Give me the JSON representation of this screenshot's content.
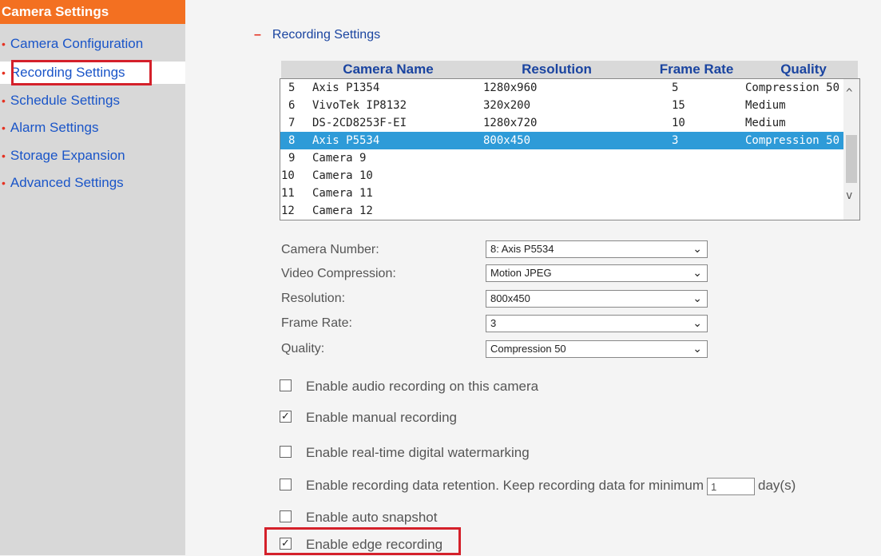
{
  "sidebar": {
    "title": "Camera Settings",
    "items": [
      {
        "label": "Camera Configuration"
      },
      {
        "label": "Recording Settings"
      },
      {
        "label": "Schedule Settings"
      },
      {
        "label": "Alarm Settings"
      },
      {
        "label": "Storage Expansion"
      },
      {
        "label": "Advanced Settings"
      }
    ],
    "bullet": "•"
  },
  "section": {
    "title": "Recording Settings",
    "collapse_glyph": "–"
  },
  "table": {
    "columns": [
      "Camera Name",
      "Resolution",
      "Frame Rate",
      "Quality"
    ],
    "rows": [
      {
        "num": "5",
        "name": "Axis P1354",
        "res": "1280x960",
        "fps": "5",
        "quality": "Compression 50"
      },
      {
        "num": "6",
        "name": "VivoTek IP8132",
        "res": "320x200",
        "fps": "15",
        "quality": "Medium"
      },
      {
        "num": "7",
        "name": "DS-2CD8253F-EI",
        "res": "1280x720",
        "fps": "10",
        "quality": "Medium"
      },
      {
        "num": "8",
        "name": "Axis P5534",
        "res": "800x450",
        "fps": "3",
        "quality": "Compression 50"
      },
      {
        "num": "9",
        "name": "Camera 9",
        "res": "",
        "fps": "",
        "quality": ""
      },
      {
        "num": "10",
        "name": "Camera 10",
        "res": "",
        "fps": "",
        "quality": ""
      },
      {
        "num": "11",
        "name": "Camera 11",
        "res": "",
        "fps": "",
        "quality": ""
      },
      {
        "num": "12",
        "name": "Camera 12",
        "res": "",
        "fps": "",
        "quality": ""
      }
    ],
    "selected_index": 3
  },
  "form": {
    "camera_number": {
      "label": "Camera Number:",
      "value": "8: Axis P5534"
    },
    "video_compression": {
      "label": "Video Compression:",
      "value": "Motion JPEG"
    },
    "resolution": {
      "label": "Resolution:",
      "value": "800x450"
    },
    "frame_rate": {
      "label": "Frame Rate:",
      "value": "3"
    },
    "quality": {
      "label": "Quality:",
      "value": "Compression 50"
    }
  },
  "options": {
    "audio": {
      "label": "Enable audio recording on this camera",
      "checked": false
    },
    "manual": {
      "label": "Enable manual recording",
      "checked": true
    },
    "watermark": {
      "label": "Enable real-time digital watermarking",
      "checked": false
    },
    "retention": {
      "label": "Enable recording data retention. Keep recording data for minimum",
      "days": "1",
      "suffix": "day(s)",
      "checked": false
    },
    "snapshot": {
      "label": "Enable auto snapshot",
      "checked": false
    },
    "edge": {
      "label": "Enable edge recording",
      "checked": true
    }
  },
  "glyphs": {
    "check": "✓",
    "chevron_down": "⌄",
    "scroll_up": "^",
    "scroll_down": "v"
  },
  "colors": {
    "accent_orange": "#f37021",
    "link_blue": "#1a55c8",
    "selection_blue": "#2e9bd8",
    "highlight_red": "#d4202a"
  }
}
